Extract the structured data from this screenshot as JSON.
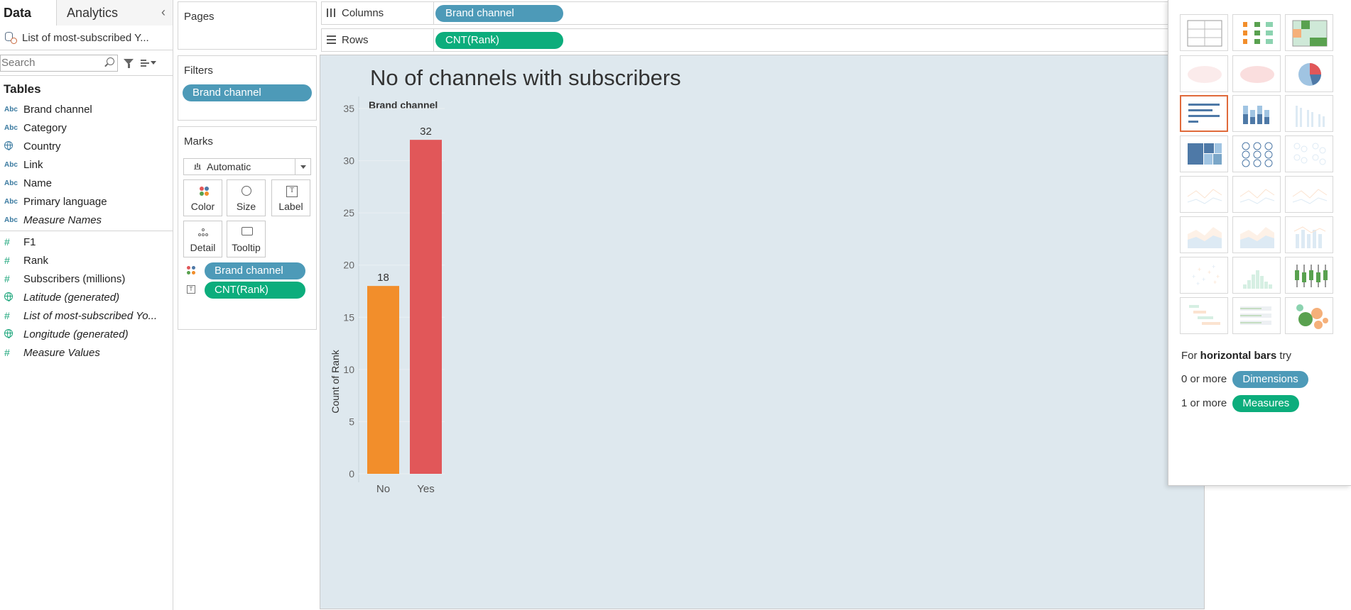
{
  "left_pane": {
    "tabs": [
      {
        "label": "Data",
        "active": true
      },
      {
        "label": "Analytics",
        "active": false
      }
    ],
    "collapse_glyph": "‹",
    "datasource": "List of most-subscribed Y...",
    "search_placeholder": "Search",
    "tables_header": "Tables",
    "dimensions": [
      {
        "type": "Abc",
        "name": "Brand channel",
        "italic": false
      },
      {
        "type": "Abc",
        "name": "Category",
        "italic": false
      },
      {
        "type": "geo-dim",
        "name": "Country",
        "italic": false
      },
      {
        "type": "Abc",
        "name": "Link",
        "italic": false
      },
      {
        "type": "Abc",
        "name": "Name",
        "italic": false
      },
      {
        "type": "Abc",
        "name": "Primary language",
        "italic": false
      },
      {
        "type": "Abc",
        "name": "Measure Names",
        "italic": true
      }
    ],
    "measures": [
      {
        "type": "#",
        "name": "F1",
        "italic": false
      },
      {
        "type": "#",
        "name": "Rank",
        "italic": false
      },
      {
        "type": "#",
        "name": "Subscribers (millions)",
        "italic": false
      },
      {
        "type": "geo",
        "name": "Latitude (generated)",
        "italic": true
      },
      {
        "type": "#",
        "name": "List of most-subscribed Yo...",
        "italic": true
      },
      {
        "type": "geo",
        "name": "Longitude (generated)",
        "italic": true
      },
      {
        "type": "#",
        "name": "Measure Values",
        "italic": true
      }
    ]
  },
  "pages": {
    "title": "Pages"
  },
  "filters": {
    "title": "Filters",
    "pill": "Brand channel"
  },
  "marks": {
    "title": "Marks",
    "type": "Automatic",
    "buttons": [
      "Color",
      "Size",
      "Label",
      "Detail",
      "Tooltip"
    ],
    "fields": [
      {
        "encoding": "color",
        "name": "Brand channel",
        "kind": "dimension"
      },
      {
        "encoding": "label",
        "name": "CNT(Rank)",
        "kind": "measure"
      }
    ]
  },
  "shelves": {
    "columns": {
      "label": "Columns",
      "pill": "Brand channel"
    },
    "rows": {
      "label": "Rows",
      "pill": "CNT(Rank)"
    }
  },
  "chart_data": {
    "type": "bar",
    "title": "No of channels with subscribers",
    "header": "Brand channel",
    "categories": [
      "No",
      "Yes"
    ],
    "values": [
      18,
      32
    ],
    "ylabel": "Count of Rank",
    "xlabel": "",
    "ylim": [
      0,
      35
    ],
    "yticks": [
      0,
      5,
      10,
      15,
      20,
      25,
      30,
      35
    ],
    "colors": [
      "#f28e2b",
      "#e15759"
    ],
    "grid": true
  },
  "show_me": {
    "hint_prefix": "For",
    "hint_chart": "horizontal bars",
    "hint_suffix": "try",
    "dim_prefix": "0 or more",
    "dim_pill": "Dimensions",
    "meas_prefix": "1 or more",
    "meas_pill": "Measures",
    "cells": [
      "text-table-icon",
      "heat-map-icon",
      "highlight-table-icon",
      "symbol-map-icon",
      "filled-map-icon",
      "pie-chart-icon",
      "horizontal-bars-icon",
      "stacked-bars-icon",
      "side-by-side-bars-icon",
      "treemap-icon",
      "circle-views-icon",
      "side-by-side-circles-icon",
      "lines-continuous-icon",
      "lines-discrete-icon",
      "dual-lines-icon",
      "area-continuous-icon",
      "area-discrete-icon",
      "dual-combination-icon",
      "scatter-plot-icon",
      "histogram-icon",
      "box-whisker-icon",
      "gantt-chart-icon",
      "bullet-graph-icon",
      "packed-bubbles-icon"
    ],
    "selected": "horizontal-bars-icon",
    "colors": {
      "dim": "#4d9ab8",
      "meas": "#0cad7c",
      "select": "#e06a3b"
    }
  }
}
